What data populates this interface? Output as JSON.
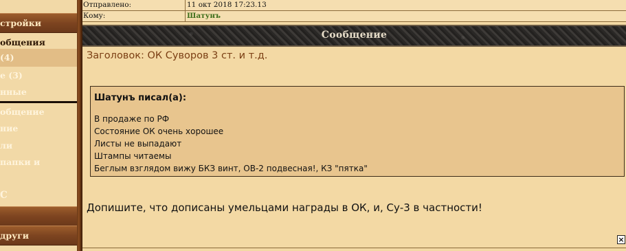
{
  "header": {
    "sent_label": "Отправлено:",
    "sent_value": "11 окт 2018 17:23.13",
    "to_label": "Кому:",
    "to_value": "Шатунъ"
  },
  "sidebar": {
    "items": [
      {
        "label": "стройки"
      },
      {
        "label": "общения"
      },
      {
        "label": " (4)"
      },
      {
        "label": "е (3)"
      },
      {
        "label": "нные"
      },
      {
        "label": "общение"
      },
      {
        "label": "ние"
      },
      {
        "label": "ли"
      },
      {
        "label": "папки и"
      },
      {
        "label": "С"
      },
      {
        "label": "други"
      }
    ]
  },
  "message_bar": {
    "title": "Сообщение"
  },
  "message": {
    "subject": "Заголовок: ОК Суворов 3 ст. и т.д.",
    "quote_header": "Шатунъ писал(а):",
    "quote_lines": [
      "В продаже по РФ",
      "Состояние ОК очень хорошее",
      "Листы не выпадают",
      "Штампы читаемы",
      "Беглым взглядом вижу БКЗ винт, ОВ-2 подвесная!, КЗ \"пятка\""
    ],
    "reply": "Допишите, что дописаны умельцами награды в ОК, и, Су-3 в частности!"
  },
  "close_icon": "close-icon"
}
